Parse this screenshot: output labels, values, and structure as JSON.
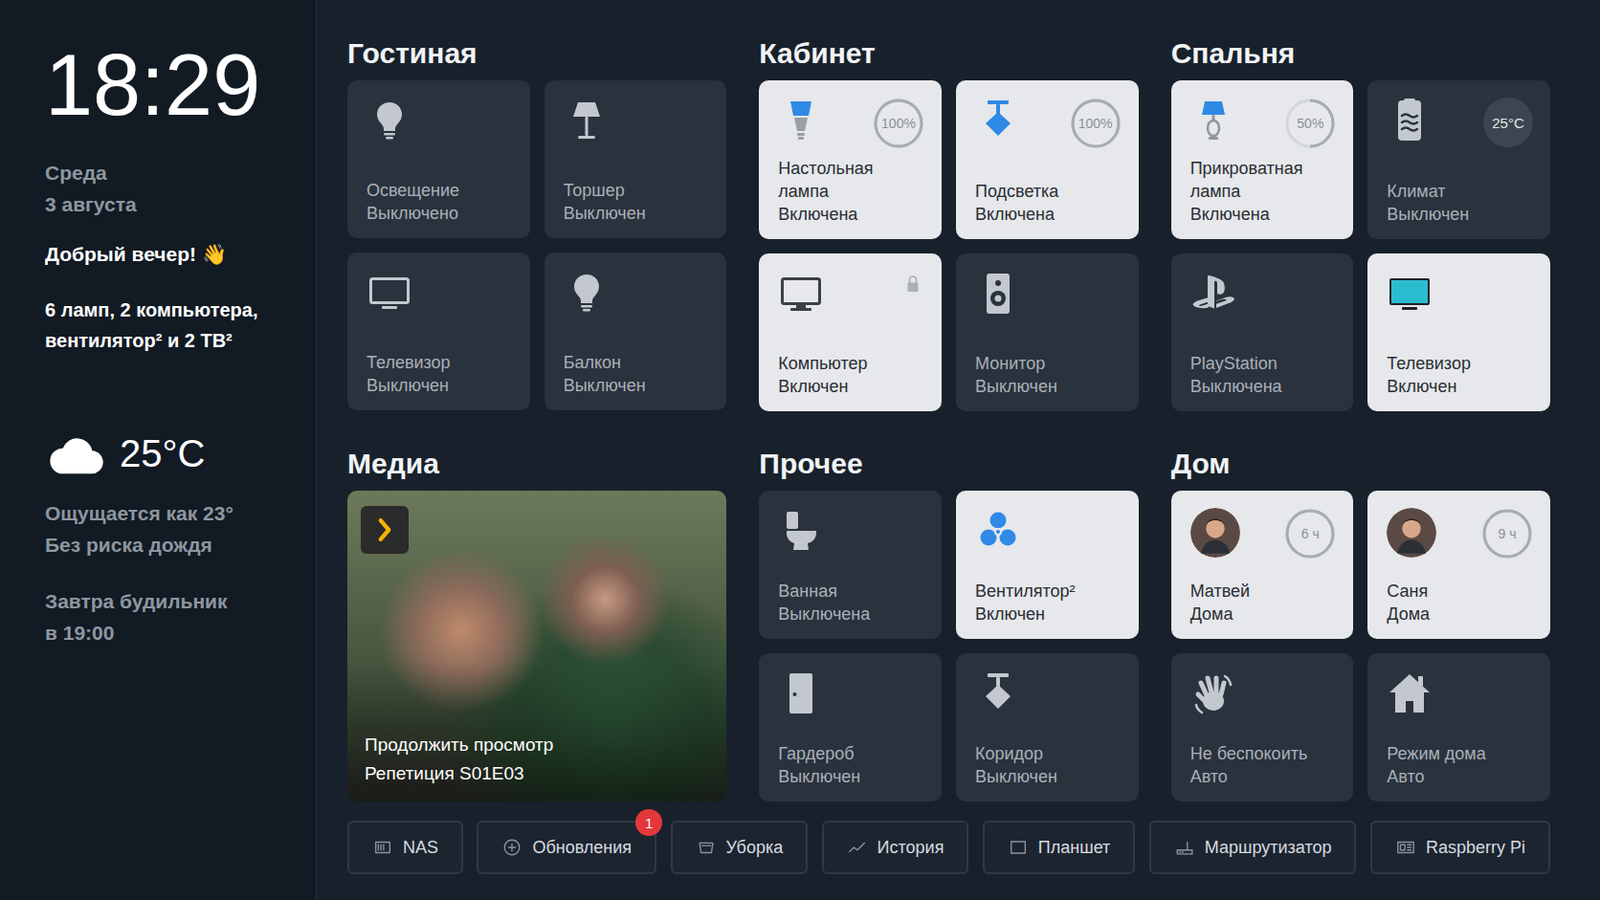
{
  "sidebar": {
    "time": "18:29",
    "day": "Среда",
    "date": "3 августа",
    "greeting": "Добрый вечер!",
    "greeting_emoji": "👋",
    "summary": "6 ламп, 2 компьютера, вентилятор² и 2 ТВ²",
    "weather": {
      "temperature": "25°C",
      "feels_like": "Ощущается как 23°",
      "rain": "Без риска дождя"
    },
    "alarm": [
      "Завтра будильник",
      "в 19:00"
    ]
  },
  "sections": [
    {
      "title": "Гостиная",
      "kind": "devices",
      "cards": [
        {
          "name": "Освещение",
          "status": "Выключено",
          "on": false,
          "kind": "bulb",
          "badge": null,
          "locked": false
        },
        {
          "name": "Торшер",
          "status": "Выключен",
          "on": false,
          "kind": "floor-lamp",
          "badge": null,
          "locked": false
        },
        {
          "name": "Телевизор",
          "status": "Выключен",
          "on": false,
          "kind": "tv",
          "badge": null,
          "locked": false
        },
        {
          "name": "Балкон",
          "status": "Выключен",
          "on": false,
          "kind": "bulb",
          "badge": null,
          "locked": false
        }
      ]
    },
    {
      "title": "Кабинет",
      "kind": "devices",
      "cards": [
        {
          "name": "Настольная лампа",
          "status": "Включена",
          "on": true,
          "kind": "desk-lamp",
          "badge": {
            "kind": "ring",
            "text": "100%",
            "level": 1
          },
          "locked": false
        },
        {
          "name": "Подсветка",
          "status": "Включена",
          "on": true,
          "kind": "spot",
          "badge": {
            "kind": "ring",
            "text": "100%",
            "level": 1
          },
          "locked": false
        },
        {
          "name": "Компьютер",
          "status": "Включен",
          "on": true,
          "kind": "computer",
          "badge": null,
          "locked": true
        },
        {
          "name": "Монитор",
          "status": "Выключен",
          "on": false,
          "kind": "speaker",
          "badge": null,
          "locked": false
        }
      ]
    },
    {
      "title": "Спальня",
      "kind": "devices",
      "cards": [
        {
          "name": "Прикроватная лампа",
          "status": "Включена",
          "on": true,
          "kind": "bed-lamp",
          "badge": {
            "kind": "ring",
            "text": "50%",
            "level": 0.5
          },
          "locked": false
        },
        {
          "name": "Климат",
          "status": "Выключен",
          "on": false,
          "kind": "climate",
          "badge": {
            "kind": "pill",
            "text": "25°C",
            "level": 1
          },
          "locked": false
        },
        {
          "name": "PlayStation",
          "status": "Выключена",
          "on": false,
          "kind": "playstation",
          "badge": null,
          "locked": false
        },
        {
          "name": "Телевизор",
          "status": "Включен",
          "on": true,
          "kind": "tv",
          "badge": null,
          "locked": false
        }
      ]
    },
    {
      "title": "Медиа",
      "kind": "media",
      "media": {
        "label": "Продолжить просмотр",
        "episode": "Репетиция S01E03"
      }
    },
    {
      "title": "Прочее",
      "kind": "devices",
      "cards": [
        {
          "name": "Ванная",
          "status": "Выключена",
          "on": false,
          "kind": "toilet",
          "badge": null,
          "locked": false
        },
        {
          "name": "Вентилятор²",
          "status": "Включен",
          "on": true,
          "kind": "fan",
          "badge": null,
          "locked": false
        },
        {
          "name": "Гардероб",
          "status": "Выключен",
          "on": false,
          "kind": "door",
          "badge": null,
          "locked": false
        },
        {
          "name": "Коридор",
          "status": "Выключен",
          "on": false,
          "kind": "spot",
          "badge": null,
          "locked": false
        }
      ]
    },
    {
      "title": "Дом",
      "kind": "devices",
      "cards": [
        {
          "name": "Матвей",
          "status": "Дома",
          "on": true,
          "kind": "person",
          "badge": {
            "kind": "ring",
            "text": "6 ч",
            "level": 1
          },
          "locked": false
        },
        {
          "name": "Саня",
          "status": "Дома",
          "on": true,
          "kind": "person",
          "badge": {
            "kind": "ring",
            "text": "9 ч",
            "level": 1
          },
          "locked": false
        },
        {
          "name": "Не беспокоить",
          "status": "Авто",
          "on": false,
          "kind": "hand",
          "badge": null,
          "locked": false
        },
        {
          "name": "Режим дома",
          "status": "Авто",
          "on": false,
          "kind": "home",
          "badge": null,
          "locked": false
        }
      ]
    }
  ],
  "toolbar": [
    {
      "label": "NAS",
      "kind": "nas",
      "badge": null
    },
    {
      "label": "Обновления",
      "kind": "updates",
      "badge": "1"
    },
    {
      "label": "Уборка",
      "kind": "vacuum",
      "badge": null
    },
    {
      "label": "История",
      "kind": "history",
      "badge": null
    },
    {
      "label": "Планшет",
      "kind": "tablet",
      "badge": null
    },
    {
      "label": "Маршрутизатор",
      "kind": "router",
      "badge": null
    },
    {
      "label": "Raspberry Pi",
      "kind": "raspberry",
      "badge": null
    }
  ]
}
